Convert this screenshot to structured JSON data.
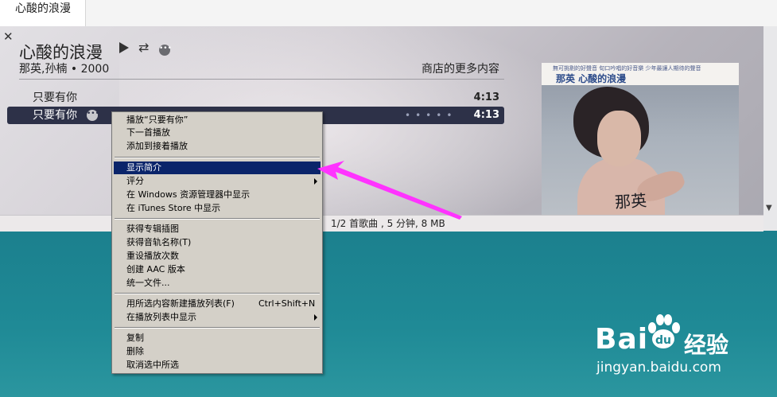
{
  "tab": {
    "label": "心酸的浪漫"
  },
  "album": {
    "title": "心酸的浪漫",
    "artist_year": "那英,孙楠 • 2000",
    "store_link": "商店的更多内容"
  },
  "tracks": [
    {
      "name": "只要有你",
      "duration": "4:13"
    },
    {
      "name": "只要有你",
      "duration": "4:13"
    }
  ],
  "album_art": {
    "small_text": "無可挑剔的好聲音  旬口吟唱的好音樂  少年最讓人期待的聲音",
    "title": "那英  心酸的浪漫",
    "signature": "那英"
  },
  "status": {
    "text": "1/2 首歌曲 , 5 分钟, 8 MB"
  },
  "context_menu": {
    "items": [
      {
        "label": "播放“只要有你”"
      },
      {
        "label": "下一首播放"
      },
      {
        "label": "添加到接着播放"
      },
      {
        "label": "显示简介"
      },
      {
        "label": "评分"
      },
      {
        "label": "在 Windows 资源管理器中显示"
      },
      {
        "label": "在 iTunes Store 中显示"
      },
      {
        "label": "获得专辑插图"
      },
      {
        "label": "获得音轨名称(T)"
      },
      {
        "label": "重设播放次数"
      },
      {
        "label": "创建 AAC 版本"
      },
      {
        "label": "统一文件..."
      },
      {
        "label": "用所选内容新建播放列表(F)",
        "shortcut": "Ctrl+Shift+N"
      },
      {
        "label": "在播放列表中显示"
      },
      {
        "label": "复制"
      },
      {
        "label": "删除"
      },
      {
        "label": "取消选中所选"
      }
    ]
  },
  "watermark": {
    "brand": "Bai",
    "brand_suffix": "经验",
    "url": "jingyan.baidu.com"
  },
  "colors": {
    "menu_highlight": "#0a246a",
    "selected_row": "#2d3148",
    "annotation_arrow": "#ff33ff",
    "desktop": "#1f8a96"
  }
}
